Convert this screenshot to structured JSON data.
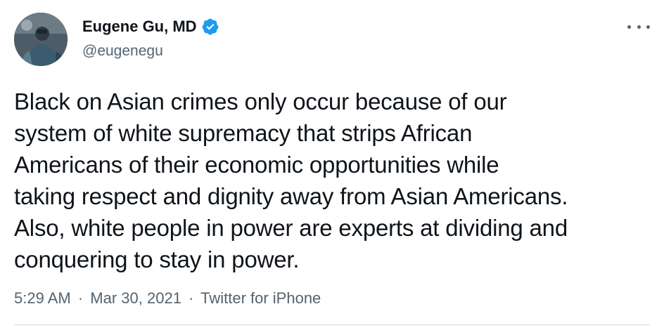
{
  "user": {
    "display_name": "Eugene Gu, MD",
    "handle": "@eugenegu",
    "verified": true,
    "avatar_icon": "profile-photo-surgeon"
  },
  "tweet": {
    "lines": [
      "Black on Asian crimes only occur because of our",
      "system of white supremacy that strips African",
      "Americans of their economic opportunities while",
      "taking respect and dignity away from Asian Americans.",
      "Also, white people in power are experts at dividing and",
      "conquering to stay in power."
    ],
    "time": "5:29 AM",
    "separator": "·",
    "date": "Mar 30, 2021",
    "source": "Twitter for iPhone"
  },
  "icons": {
    "verified": "verified-badge-icon",
    "more": "more-options-icon"
  },
  "colors": {
    "text": "#0f1419",
    "secondary": "#536471",
    "verified": "#1d9bf0",
    "divider": "#cfd9de"
  }
}
